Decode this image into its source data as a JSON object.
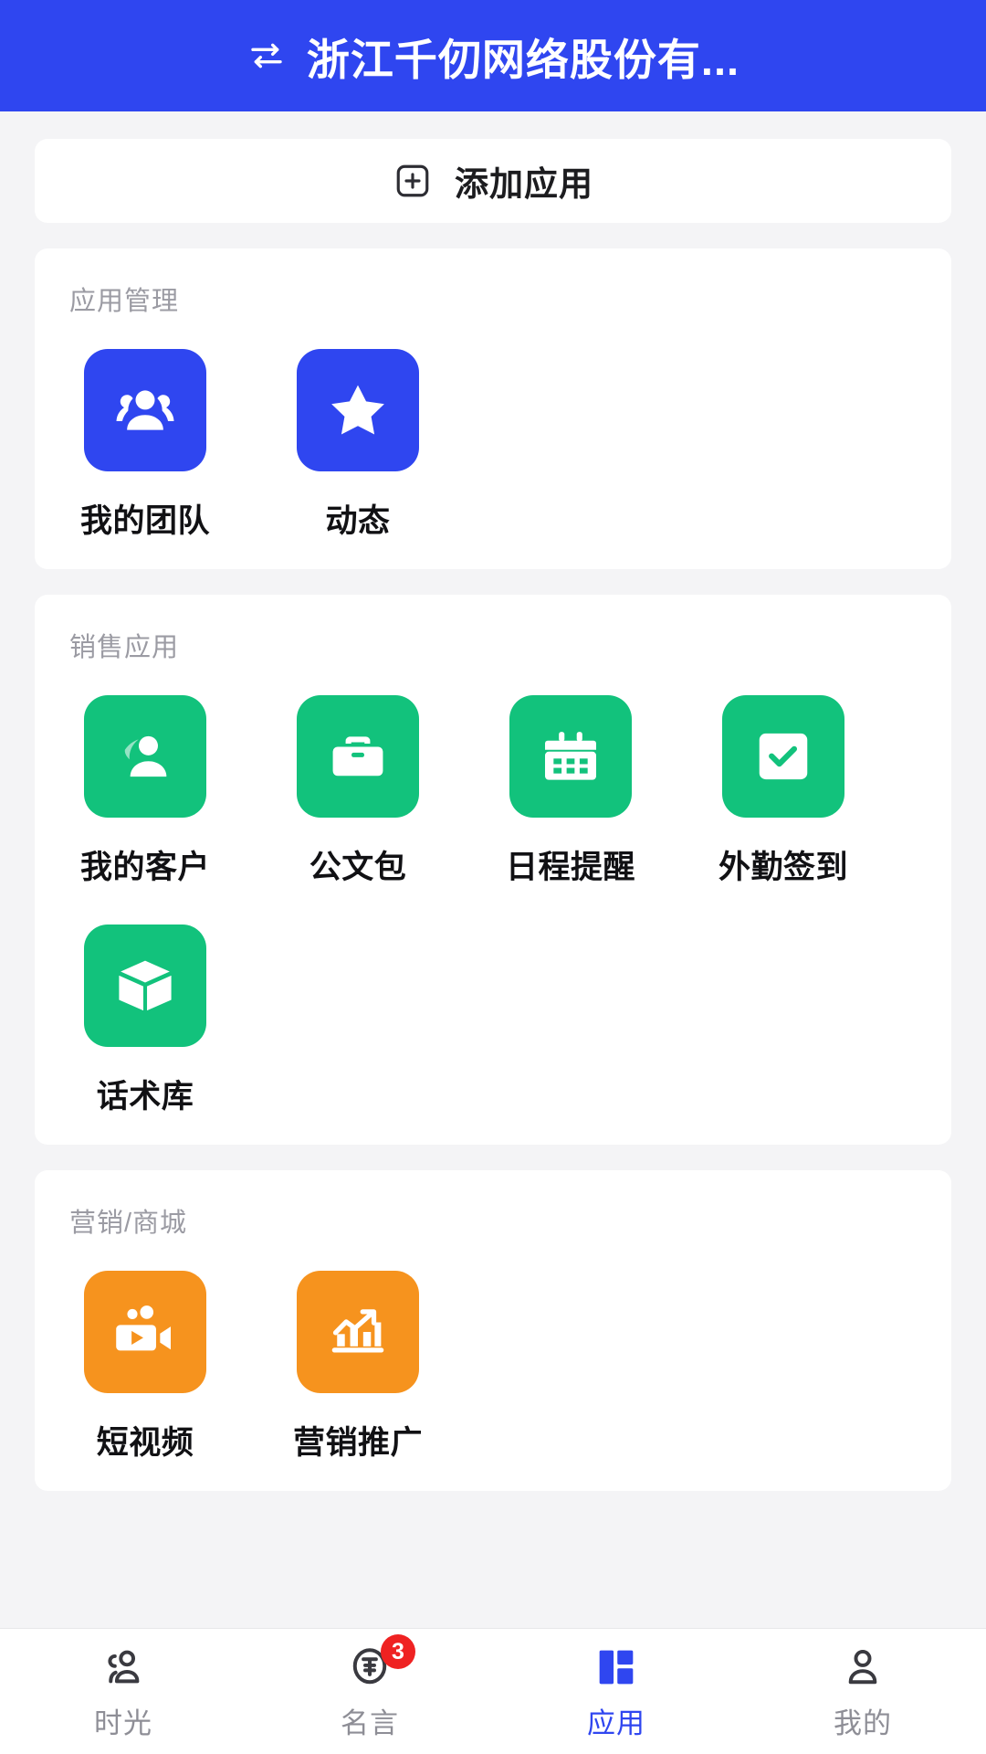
{
  "header": {
    "switch_icon": "swap-icon",
    "title": "浙江千仞网络股份有..."
  },
  "add_app": {
    "icon": "plus-square-icon",
    "label": "添加应用"
  },
  "sections": [
    {
      "title": "应用管理",
      "color": "#2f46f0",
      "apps": [
        {
          "label": "我的团队",
          "icon": "group-users-icon",
          "color_class": "blue"
        },
        {
          "label": "动态",
          "icon": "star-icon",
          "color_class": "blue"
        }
      ]
    },
    {
      "title": "销售应用",
      "color": "#12c27c",
      "apps": [
        {
          "label": "我的客户",
          "icon": "user-customer-icon",
          "color_class": "green"
        },
        {
          "label": "公文包",
          "icon": "briefcase-icon",
          "color_class": "green"
        },
        {
          "label": "日程提醒",
          "icon": "calendar-icon",
          "color_class": "green"
        },
        {
          "label": "外勤签到",
          "icon": "checklist-board-icon",
          "color_class": "green"
        },
        {
          "label": "话术库",
          "icon": "box-3d-icon",
          "color_class": "green"
        }
      ]
    },
    {
      "title": "营销/商城",
      "color": "#f6931e",
      "apps": [
        {
          "label": "短视频",
          "icon": "video-camera-icon",
          "color_class": "orange"
        },
        {
          "label": "营销推广",
          "icon": "growth-chart-icon",
          "color_class": "orange"
        }
      ]
    }
  ],
  "tabbar": {
    "active_color": "#2f46f0",
    "inactive_color": "#8e8e96",
    "items": [
      {
        "label": "时光",
        "icon": "people-time-icon",
        "active": false,
        "badge": ""
      },
      {
        "label": "名言",
        "icon": "quote-speech-icon",
        "active": false,
        "badge": "3"
      },
      {
        "label": "应用",
        "icon": "grid-apps-icon",
        "active": true,
        "badge": ""
      },
      {
        "label": "我的",
        "icon": "person-icon",
        "active": false,
        "badge": ""
      }
    ]
  }
}
